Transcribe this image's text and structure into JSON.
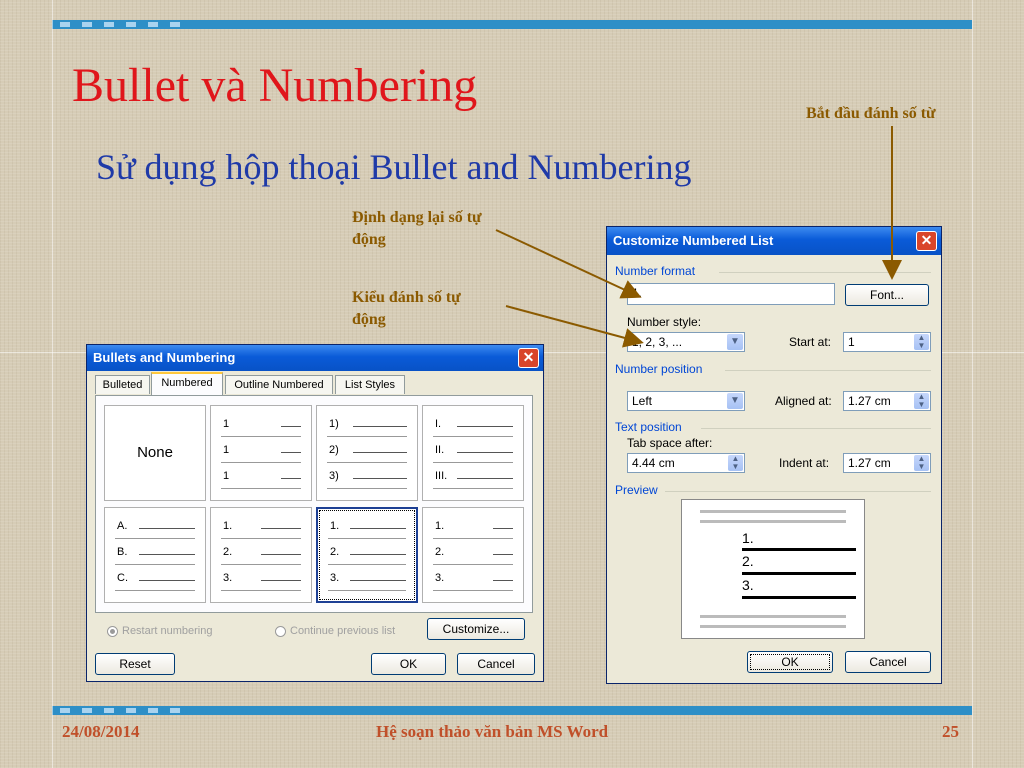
{
  "slide": {
    "title": "Bullet và Numbering",
    "subtitle": "Sử dụng hộp thoại Bullet and Numbering"
  },
  "callouts": {
    "start_at": "Bắt đầu đánh số từ",
    "reformat_line1": "Định dạng lại số tự",
    "reformat_line2": "động",
    "style_line1": "Kiểu đánh số tự",
    "style_line2": "động"
  },
  "bullets_dialog": {
    "title": "Bullets and Numbering",
    "tabs": [
      "Bulleted",
      "Numbered",
      "Outline Numbered",
      "List Styles"
    ],
    "active_tab": "Numbered",
    "gallery_none": "None",
    "gallery": [
      [
        "1",
        "1",
        "1"
      ],
      [
        "1)",
        "2)",
        "3)"
      ],
      [
        "I.",
        "II.",
        "III."
      ],
      [
        "A.",
        "B.",
        "C."
      ],
      [
        "1.",
        "2.",
        "3."
      ],
      [
        "1.",
        "2.",
        "3."
      ],
      [
        "1.",
        "2.",
        "3."
      ]
    ],
    "restart_numbering": "Restart numbering",
    "continue_previous": "Continue previous list",
    "customize_button": "Customize...",
    "reset_button": "Reset",
    "ok_button": "OK",
    "cancel_button": "Cancel"
  },
  "customize_dialog": {
    "title": "Customize Numbered List",
    "number_format_group": "Number format",
    "number_format_value": "1.",
    "font_button": "Font...",
    "number_style_label": "Number style:",
    "number_style_value": "1, 2, 3, ...",
    "start_at_label": "Start at:",
    "start_at_value": "1",
    "number_position_group": "Number position",
    "number_position_value": "Left",
    "aligned_at_label": "Aligned at:",
    "aligned_at_value": "1.27 cm",
    "text_position_group": "Text position",
    "tab_space_label": "Tab space after:",
    "tab_space_value": "4.44 cm",
    "indent_at_label": "Indent at:",
    "indent_at_value": "1.27 cm",
    "preview_group": "Preview",
    "preview_items": [
      "1.",
      "2.",
      "3."
    ],
    "ok_button": "OK",
    "cancel_button": "Cancel"
  },
  "footer": {
    "date": "24/08/2014",
    "center": "Hệ soạn thảo văn bản MS Word",
    "page": "25"
  },
  "colors": {
    "title": "#e0161b",
    "subtitle": "#1f3aa8",
    "callout": "#8b5a00",
    "band": "#2e8fc7",
    "footer": "#c0502a"
  }
}
